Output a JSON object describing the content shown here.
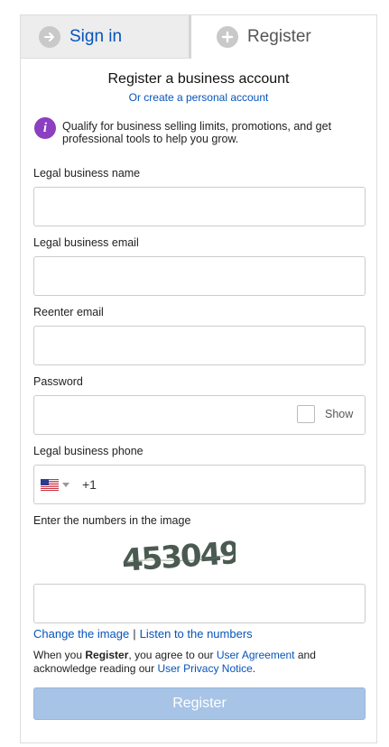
{
  "tabs": {
    "signin_label": "Sign in",
    "register_label": "Register"
  },
  "heading": {
    "title": "Register a business account",
    "alt_link": "Or create a personal account"
  },
  "info": {
    "icon": "info-icon",
    "text": "Qualify for business selling limits, promotions, and get professional tools to help you grow."
  },
  "fields": {
    "business_name_label": "Legal business name",
    "business_name_value": "",
    "business_email_label": "Legal business email",
    "business_email_value": "",
    "reenter_email_label": "Reenter email",
    "reenter_email_value": "",
    "password_label": "Password",
    "password_value": "",
    "show_label": "Show",
    "phone_label": "Legal business phone",
    "phone_country": "US",
    "phone_code": "+1",
    "phone_value": ""
  },
  "captcha": {
    "label": "Enter the numbers in the image",
    "image_text": "453049",
    "input_value": "",
    "change_link": "Change the image",
    "separator": "|",
    "listen_link": "Listen to the numbers"
  },
  "legal": {
    "prefix": "When you ",
    "bold": "Register",
    "middle": ", you agree to our ",
    "user_agreement": "User Agreement",
    "and_text": " and acknowledge reading our ",
    "privacy_notice": "User Privacy Notice",
    "suffix": "."
  },
  "register_button": "Register",
  "colors": {
    "link": "#0654ba",
    "info_badge": "#8b3fc1",
    "button_disabled": "#a7c4e6"
  }
}
